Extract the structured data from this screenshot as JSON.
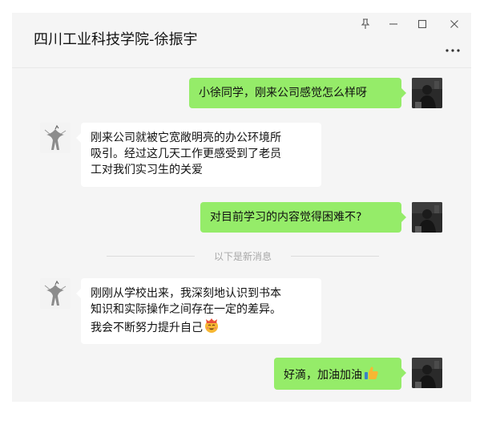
{
  "window": {
    "title": "四川工业科技学院-徐振宇"
  },
  "controls": {
    "pin": "pin-icon",
    "minimize": "minimize-icon",
    "maximize": "maximize-icon",
    "close": "close-icon",
    "more": "more-icon"
  },
  "messages": [
    {
      "sender": "me",
      "text": "小徐同学，刚来公司感觉怎么样呀"
    },
    {
      "sender": "peer",
      "text": "刚来公司就被它宽敞明亮的办公环境所\n吸引。经过这几天工作更感受到了老员\n工对我们实习生的关爱"
    },
    {
      "sender": "me",
      "text": "对目前学习的内容觉得困难不?"
    },
    {
      "sender": "peer",
      "text": "刚刚从学校出来，我深刻地认识到书本\n知识和实际操作之间存在一定的差异。\n我会不断努力提升自己",
      "emoji": "face-emoji"
    },
    {
      "sender": "me",
      "text": "好滴，加油加油",
      "emoji": "thumbs-up-emoji"
    }
  ],
  "separator": {
    "label": "以下是新消息"
  },
  "colors": {
    "my_bubble": "#95ec69",
    "peer_bubble": "#ffffff",
    "background": "#f5f5f5"
  }
}
